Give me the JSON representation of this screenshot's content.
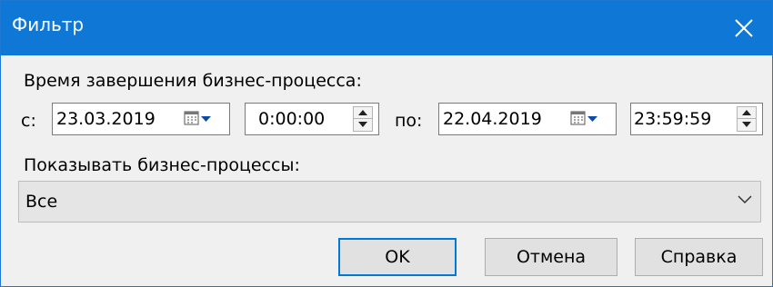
{
  "window": {
    "title": "Фильтр"
  },
  "labels": {
    "completion_time": "Время завершения бизнес-процесса:",
    "from": "с:",
    "to": "по:",
    "show_processes": "Показывать бизнес-процессы:"
  },
  "fields": {
    "from_date": "23.03.2019",
    "from_time": "0:00:00",
    "to_date": "22.04.2019",
    "to_time": "23:59:59"
  },
  "filter": {
    "selected": "Все"
  },
  "buttons": {
    "ok": "OK",
    "cancel": "Отмена",
    "help": "Справка"
  },
  "icons": {
    "close": "close-icon",
    "calendar": "calendar-icon",
    "dropdown": "chevron-down-icon",
    "spin_up": "arrow-up-icon",
    "spin_down": "arrow-down-icon"
  },
  "colors": {
    "titlebar": "#0f78d7",
    "focus": "#0078d7"
  }
}
